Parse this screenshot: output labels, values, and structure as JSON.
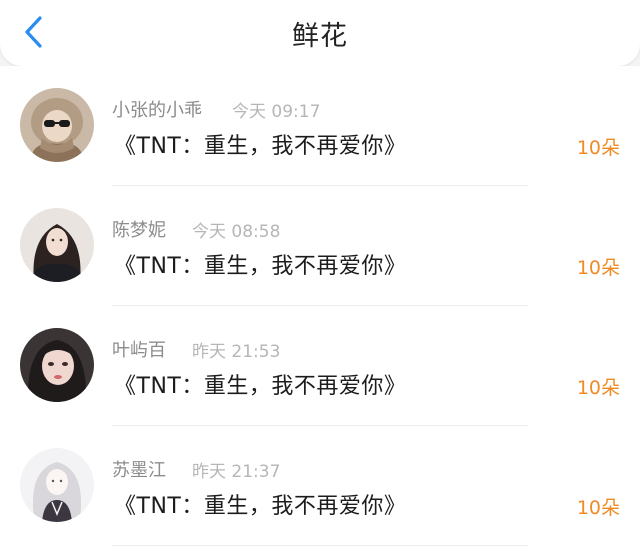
{
  "header": {
    "title": "鲜花",
    "back_icon": "chevron-left-icon",
    "accent": "#2a8cf0"
  },
  "items": [
    {
      "name": "小张的小乖",
      "time": "今天 09:17",
      "book": "《TNT：重生，我不再爱你》",
      "count": "10朵"
    },
    {
      "name": "陈梦妮",
      "time": "今天 08:58",
      "book": "《TNT：重生，我不再爱你》",
      "count": "10朵"
    },
    {
      "name": "叶屿百",
      "time": "昨天 21:53",
      "book": "《TNT：重生，我不再爱你》",
      "count": "10朵"
    },
    {
      "name": "苏墨江",
      "time": "昨天 21:37",
      "book": "《TNT：重生，我不再爱你》",
      "count": "10朵"
    }
  ],
  "colors": {
    "count": "#f08a24",
    "name": "#8c8c8c",
    "time": "#b6b6b6"
  }
}
